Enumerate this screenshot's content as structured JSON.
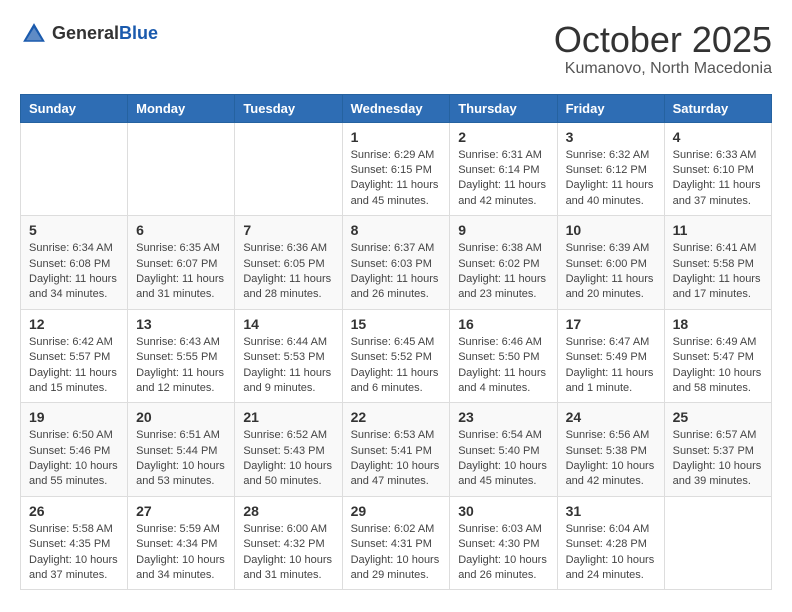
{
  "header": {
    "logo": {
      "text_general": "General",
      "text_blue": "Blue"
    },
    "title": "October 2025",
    "location": "Kumanovo, North Macedonia"
  },
  "weekdays": [
    "Sunday",
    "Monday",
    "Tuesday",
    "Wednesday",
    "Thursday",
    "Friday",
    "Saturday"
  ],
  "weeks": [
    [
      {
        "day": "",
        "info": ""
      },
      {
        "day": "",
        "info": ""
      },
      {
        "day": "",
        "info": ""
      },
      {
        "day": "1",
        "info": "Sunrise: 6:29 AM\nSunset: 6:15 PM\nDaylight: 11 hours and 45 minutes."
      },
      {
        "day": "2",
        "info": "Sunrise: 6:31 AM\nSunset: 6:14 PM\nDaylight: 11 hours and 42 minutes."
      },
      {
        "day": "3",
        "info": "Sunrise: 6:32 AM\nSunset: 6:12 PM\nDaylight: 11 hours and 40 minutes."
      },
      {
        "day": "4",
        "info": "Sunrise: 6:33 AM\nSunset: 6:10 PM\nDaylight: 11 hours and 37 minutes."
      }
    ],
    [
      {
        "day": "5",
        "info": "Sunrise: 6:34 AM\nSunset: 6:08 PM\nDaylight: 11 hours and 34 minutes."
      },
      {
        "day": "6",
        "info": "Sunrise: 6:35 AM\nSunset: 6:07 PM\nDaylight: 11 hours and 31 minutes."
      },
      {
        "day": "7",
        "info": "Sunrise: 6:36 AM\nSunset: 6:05 PM\nDaylight: 11 hours and 28 minutes."
      },
      {
        "day": "8",
        "info": "Sunrise: 6:37 AM\nSunset: 6:03 PM\nDaylight: 11 hours and 26 minutes."
      },
      {
        "day": "9",
        "info": "Sunrise: 6:38 AM\nSunset: 6:02 PM\nDaylight: 11 hours and 23 minutes."
      },
      {
        "day": "10",
        "info": "Sunrise: 6:39 AM\nSunset: 6:00 PM\nDaylight: 11 hours and 20 minutes."
      },
      {
        "day": "11",
        "info": "Sunrise: 6:41 AM\nSunset: 5:58 PM\nDaylight: 11 hours and 17 minutes."
      }
    ],
    [
      {
        "day": "12",
        "info": "Sunrise: 6:42 AM\nSunset: 5:57 PM\nDaylight: 11 hours and 15 minutes."
      },
      {
        "day": "13",
        "info": "Sunrise: 6:43 AM\nSunset: 5:55 PM\nDaylight: 11 hours and 12 minutes."
      },
      {
        "day": "14",
        "info": "Sunrise: 6:44 AM\nSunset: 5:53 PM\nDaylight: 11 hours and 9 minutes."
      },
      {
        "day": "15",
        "info": "Sunrise: 6:45 AM\nSunset: 5:52 PM\nDaylight: 11 hours and 6 minutes."
      },
      {
        "day": "16",
        "info": "Sunrise: 6:46 AM\nSunset: 5:50 PM\nDaylight: 11 hours and 4 minutes."
      },
      {
        "day": "17",
        "info": "Sunrise: 6:47 AM\nSunset: 5:49 PM\nDaylight: 11 hours and 1 minute."
      },
      {
        "day": "18",
        "info": "Sunrise: 6:49 AM\nSunset: 5:47 PM\nDaylight: 10 hours and 58 minutes."
      }
    ],
    [
      {
        "day": "19",
        "info": "Sunrise: 6:50 AM\nSunset: 5:46 PM\nDaylight: 10 hours and 55 minutes."
      },
      {
        "day": "20",
        "info": "Sunrise: 6:51 AM\nSunset: 5:44 PM\nDaylight: 10 hours and 53 minutes."
      },
      {
        "day": "21",
        "info": "Sunrise: 6:52 AM\nSunset: 5:43 PM\nDaylight: 10 hours and 50 minutes."
      },
      {
        "day": "22",
        "info": "Sunrise: 6:53 AM\nSunset: 5:41 PM\nDaylight: 10 hours and 47 minutes."
      },
      {
        "day": "23",
        "info": "Sunrise: 6:54 AM\nSunset: 5:40 PM\nDaylight: 10 hours and 45 minutes."
      },
      {
        "day": "24",
        "info": "Sunrise: 6:56 AM\nSunset: 5:38 PM\nDaylight: 10 hours and 42 minutes."
      },
      {
        "day": "25",
        "info": "Sunrise: 6:57 AM\nSunset: 5:37 PM\nDaylight: 10 hours and 39 minutes."
      }
    ],
    [
      {
        "day": "26",
        "info": "Sunrise: 5:58 AM\nSunset: 4:35 PM\nDaylight: 10 hours and 37 minutes."
      },
      {
        "day": "27",
        "info": "Sunrise: 5:59 AM\nSunset: 4:34 PM\nDaylight: 10 hours and 34 minutes."
      },
      {
        "day": "28",
        "info": "Sunrise: 6:00 AM\nSunset: 4:32 PM\nDaylight: 10 hours and 31 minutes."
      },
      {
        "day": "29",
        "info": "Sunrise: 6:02 AM\nSunset: 4:31 PM\nDaylight: 10 hours and 29 minutes."
      },
      {
        "day": "30",
        "info": "Sunrise: 6:03 AM\nSunset: 4:30 PM\nDaylight: 10 hours and 26 minutes."
      },
      {
        "day": "31",
        "info": "Sunrise: 6:04 AM\nSunset: 4:28 PM\nDaylight: 10 hours and 24 minutes."
      },
      {
        "day": "",
        "info": ""
      }
    ]
  ]
}
